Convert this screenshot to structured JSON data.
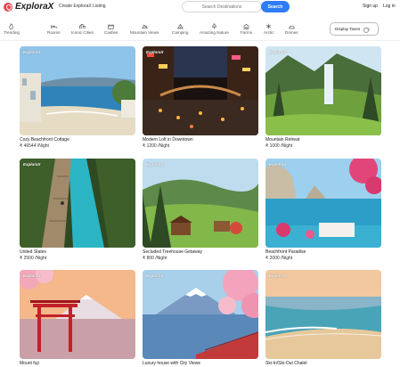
{
  "header": {
    "logo_text": "ExploraX",
    "create_listing": "Create ExploraX Listing",
    "search_placeholder": "Search Destinations",
    "search_button": "Search",
    "signup": "Sign up",
    "login": "Log in"
  },
  "categories": [
    {
      "label": "Trending",
      "icon": "fire-icon"
    },
    {
      "label": "Rooms",
      "icon": "bed-icon"
    },
    {
      "label": "Iconic Cities",
      "icon": "city-icon"
    },
    {
      "label": "Castles",
      "icon": "castle-icon"
    },
    {
      "label": "Mountain Views",
      "icon": "mountain-icon"
    },
    {
      "label": "Camping",
      "icon": "tent-icon"
    },
    {
      "label": "Amazing Nature",
      "icon": "tree-icon"
    },
    {
      "label": "Farms",
      "icon": "farm-icon"
    },
    {
      "label": "Arctic",
      "icon": "snowflake-icon"
    },
    {
      "label": "Domes",
      "icon": "dome-icon"
    }
  ],
  "tax_toggle_label": "Display Taxes",
  "badge_text": "ExploraX",
  "listings": [
    {
      "title": "Cozy Beachfront Cottage",
      "price": "₹ 46544 /Night"
    },
    {
      "title": "Modern Loft in Downtown",
      "price": "₹ 1200 /Night"
    },
    {
      "title": "Mountain Retreat",
      "price": "₹ 1000 /Night"
    },
    {
      "title": "United States",
      "price": "₹ 2500 /Night"
    },
    {
      "title": "Secluded Treehouse Getaway",
      "price": "₹ 800 /Night"
    },
    {
      "title": "Beachfront Paradise",
      "price": "₹ 2000 /Night"
    },
    {
      "title": "Mount fuji",
      "price": ""
    },
    {
      "title": "Luxury house with City Views",
      "price": ""
    },
    {
      "title": "Ski-In/Ski-Out Chalet",
      "price": ""
    }
  ]
}
